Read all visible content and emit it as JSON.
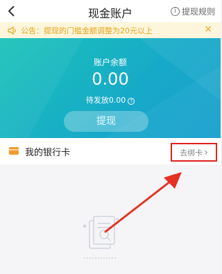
{
  "nav": {
    "title": "现金账户",
    "rules_label": "提现规则",
    "info_glyph": "i"
  },
  "notice": {
    "text": "公告：提现的门槛金额调整为20元以上",
    "close_glyph": "×"
  },
  "balance": {
    "label": "账户余额",
    "amount": "0.00",
    "pending": "待发放0.00",
    "help_glyph": "?",
    "withdraw_label": "提现"
  },
  "bank_card": {
    "label": "我的银行卡",
    "bind_label": "去绑卡",
    "bind_chevron": "›"
  },
  "colors": {
    "accent": "#1bb6c4",
    "notice_text": "#e8a418",
    "highlight": "#e02020"
  },
  "icons": [
    "back-icon",
    "info-icon",
    "speaker-icon",
    "close-icon",
    "help-icon",
    "bank-card-icon",
    "chevron-right-icon",
    "empty-document-icon",
    "annotation-arrow"
  ]
}
